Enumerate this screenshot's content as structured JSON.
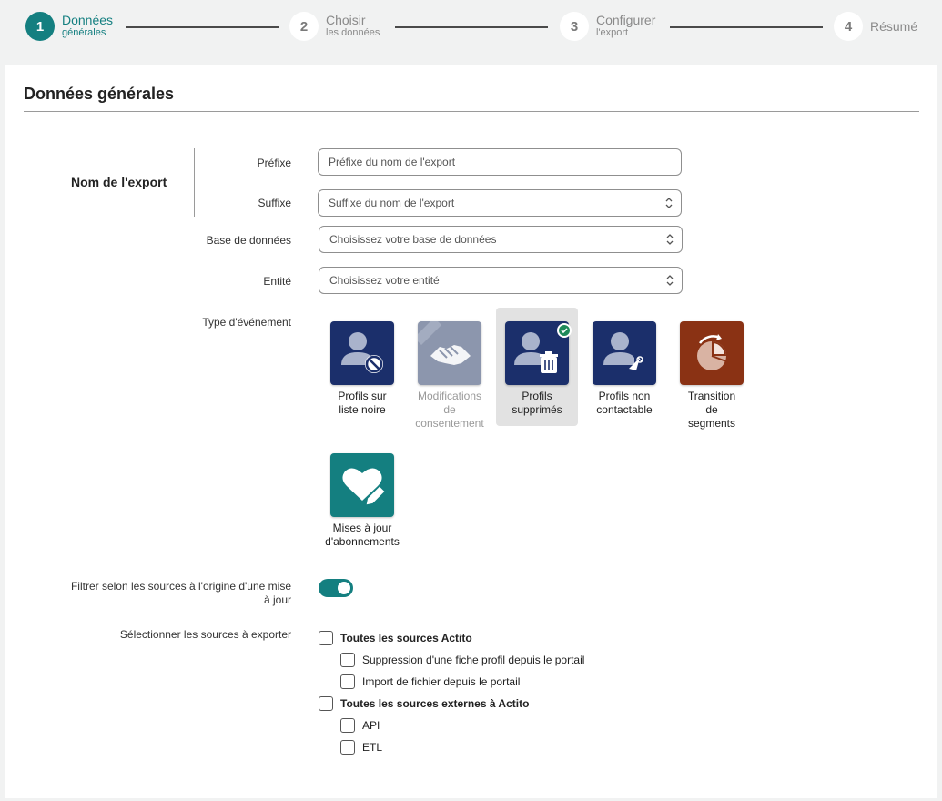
{
  "stepper": {
    "steps": [
      {
        "number": "1",
        "title": "Données",
        "subtitle": "générales"
      },
      {
        "number": "2",
        "title": "Choisir",
        "subtitle": "les données"
      },
      {
        "number": "3",
        "title": "Configurer",
        "subtitle": "l'export"
      },
      {
        "number": "4",
        "title": "Résumé",
        "subtitle": ""
      }
    ],
    "active_step": 1
  },
  "section": {
    "title": "Données générales"
  },
  "export_name": {
    "group_label": "Nom de l'export",
    "prefix_label": "Préfixe",
    "prefix_placeholder": "Préfixe du nom de l'export",
    "suffix_label": "Suffixe",
    "suffix_placeholder": "Suffixe du nom de l'export"
  },
  "database": {
    "label": "Base de données",
    "placeholder": "Choisissez votre base de données"
  },
  "entity": {
    "label": "Entité",
    "placeholder": "Choisissez votre entité"
  },
  "event_type": {
    "label": "Type d'événement",
    "tiles": [
      {
        "line1": "Profils sur",
        "line2": "liste noire",
        "line3": "",
        "icon": "profile-blacklist-icon",
        "color": "#1b2f6b",
        "selected": false,
        "disabled": false
      },
      {
        "line1": "Modifications",
        "line2": "de",
        "line3": "consentement",
        "icon": "handshake-icon",
        "color": "#8c96ad",
        "selected": false,
        "disabled": true
      },
      {
        "line1": "Profils",
        "line2": "supprimés",
        "line3": "",
        "icon": "profile-deleted-icon",
        "color": "#1b2f6b",
        "selected": true,
        "disabled": false
      },
      {
        "line1": "Profils non",
        "line2": "contactable",
        "line3": "",
        "icon": "profile-uncontactable-icon",
        "color": "#1b2f6b",
        "selected": false,
        "disabled": false
      },
      {
        "line1": "Transition",
        "line2": "de",
        "line3": "segments",
        "icon": "segment-transition-icon",
        "color": "#8a3214",
        "selected": false,
        "disabled": false
      },
      {
        "line1": "Mises à jour",
        "line2": "d'abonnements",
        "line3": "",
        "icon": "subscription-update-icon",
        "color": "#147f80",
        "selected": false,
        "disabled": false
      }
    ]
  },
  "filter": {
    "label_line1": "Filtrer selon les sources à l'origine d'une mise",
    "label_line2": "à jour",
    "enabled": true
  },
  "sources": {
    "label": "Sélectionner les sources à exporter",
    "groups": [
      {
        "label": "Toutes les sources Actito",
        "items": [
          "Suppression d'une fiche profil depuis le portail",
          "Import de fichier depuis le portail"
        ]
      },
      {
        "label": "Toutes les sources externes à Actito",
        "items": [
          "API",
          "ETL"
        ]
      }
    ]
  },
  "colors": {
    "accent": "#147f80",
    "navy": "#1b2f6b",
    "rust": "#8a3214",
    "success": "#1f8a5a"
  }
}
